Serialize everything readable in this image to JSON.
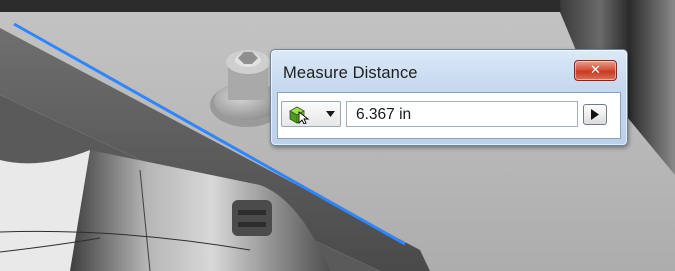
{
  "dialog": {
    "title": "Measure Distance",
    "close_label": "✕",
    "measurement_value": "6.367 in",
    "selector_icon": "select-cube-icon",
    "expand_icon": "triangle-right-icon"
  },
  "colors": {
    "measure_edge": "#2f86ff",
    "close_red": "#d34e34",
    "dialog_frame": "#c6d8ee"
  }
}
